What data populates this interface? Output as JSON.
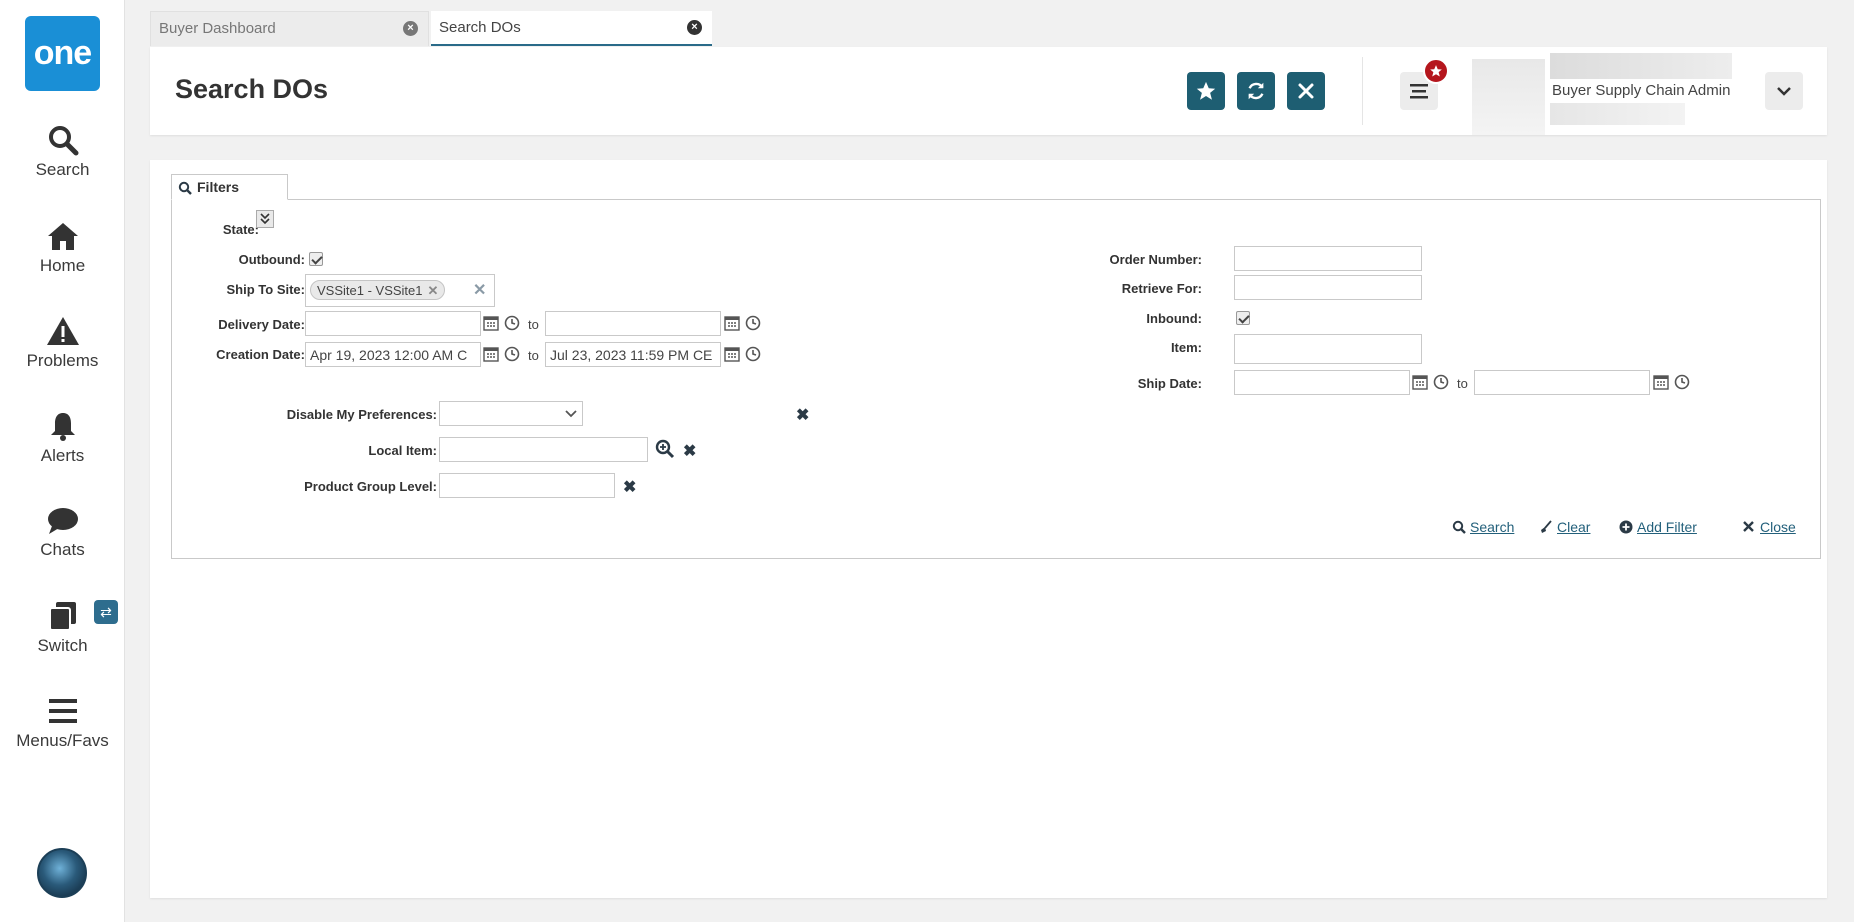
{
  "nav": {
    "logo": "one",
    "items": [
      {
        "label": "Search",
        "icon": "search-icon"
      },
      {
        "label": "Home",
        "icon": "home-icon"
      },
      {
        "label": "Problems",
        "icon": "warning-icon"
      },
      {
        "label": "Alerts",
        "icon": "bell-icon"
      },
      {
        "label": "Chats",
        "icon": "chat-icon"
      },
      {
        "label": "Switch",
        "icon": "switch-icon"
      },
      {
        "label": "Menus/Favs",
        "icon": "hamburger-icon"
      }
    ]
  },
  "tabs": [
    {
      "label": "Buyer Dashboard",
      "active": false
    },
    {
      "label": "Search DOs",
      "active": true
    }
  ],
  "header": {
    "title": "Search DOs",
    "user_name": "Buyer Supply Chain Admin",
    "accent": "#1e5e72",
    "badge_color": "#b5161d"
  },
  "filters": {
    "tab_label": "Filters",
    "state_label": "State:",
    "outbound_label": "Outbound:",
    "outbound_checked": true,
    "ship_to_site_label": "Ship To Site:",
    "ship_to_site_chip": "VSSite1 - VSSite1",
    "delivery_date_label": "Delivery Date:",
    "delivery_from": "",
    "delivery_to": "",
    "creation_date_label": "Creation Date:",
    "creation_from": "Apr 19, 2023 12:00 AM C",
    "creation_to": "Jul 23, 2023 11:59 PM CE",
    "to_text": "to",
    "order_number_label": "Order Number:",
    "retrieve_for_label": "Retrieve For:",
    "inbound_label": "Inbound:",
    "inbound_checked": true,
    "item_label": "Item:",
    "ship_date_label": "Ship Date:",
    "disable_prefs_label": "Disable My Preferences:",
    "local_item_label": "Local Item:",
    "product_group_label": "Product Group Level:",
    "actions": {
      "search": "Search",
      "clear": "Clear",
      "add_filter": "Add Filter",
      "close": "Close"
    }
  }
}
